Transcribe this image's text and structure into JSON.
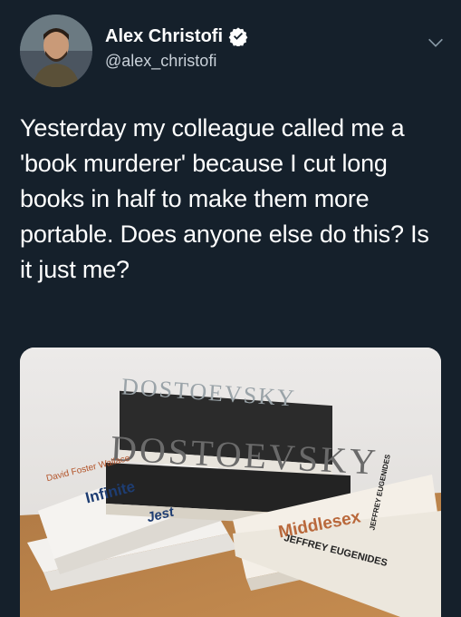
{
  "author": {
    "display_name": "Alex Christofi",
    "handle": "@alex_christofi",
    "verified": true,
    "avatar_icon": "person-avatar-icon"
  },
  "tweet": {
    "text": "Yesterday my colleague called me a 'book murderer' because I cut long books in half to make them more portable. Does anyone else do this? Is it just me?"
  },
  "media": {
    "spines": {
      "top_book": "DOSTOEVSKY",
      "middle_book": "DOSTOEVSKY",
      "left_book_title": "Infinite",
      "left_book_sub": "Jest",
      "left_book_author_a": "David Foster Wallace",
      "right_book_title": "Middlesex",
      "right_book_author": "JEFFREY EUGENIDES",
      "right_book_vertical": "JEFFREY EUGENIDES"
    }
  },
  "colors": {
    "background": "#15202b",
    "text": "#ffffff",
    "verified_blue": "#ffffff"
  }
}
